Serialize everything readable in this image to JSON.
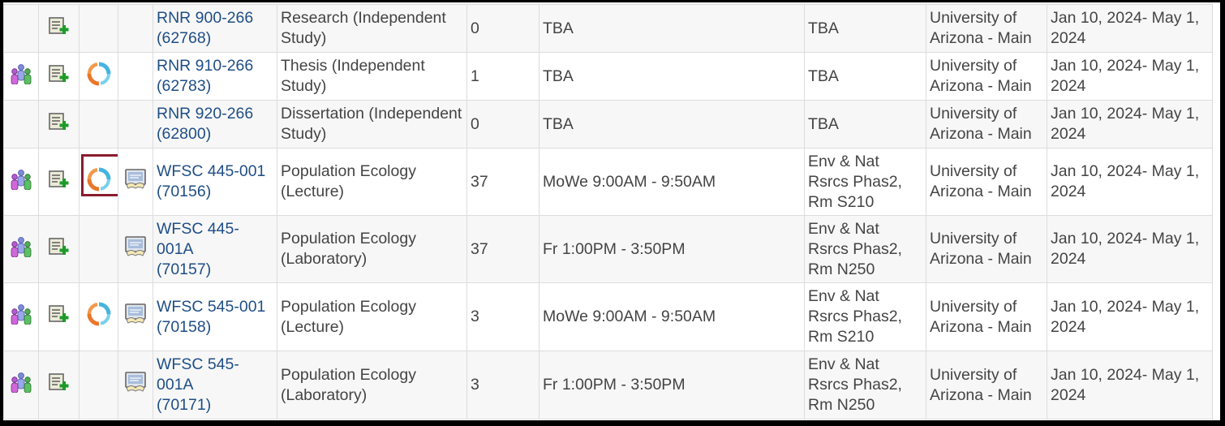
{
  "colors": {
    "link": "#1f4e86",
    "text": "#444444",
    "row_alt": "#f7f7f7",
    "highlight_box": "#8a1c2e"
  },
  "icons": {
    "roster": "group-people-icon",
    "add_to_cart": "add-document-icon",
    "swap": "refresh-cycle-icon",
    "online": "online-course-icon"
  },
  "rows": [
    {
      "has_roster": false,
      "has_add": true,
      "has_swap": false,
      "has_online": false,
      "swap_highlighted": false,
      "class_line1": "RNR 900-266",
      "class_line2": "(62768)",
      "class_line3": "",
      "title": "Research (Independent Study)",
      "enrolled": "0",
      "days_times": "TBA",
      "room": "TBA",
      "campus": "University of Arizona - Main",
      "dates": "Jan 10, 2024- May 1, 2024"
    },
    {
      "has_roster": true,
      "has_add": true,
      "has_swap": true,
      "has_online": false,
      "swap_highlighted": false,
      "class_line1": "RNR 910-266",
      "class_line2": "(62783)",
      "class_line3": "",
      "title": "Thesis (Independent Study)",
      "enrolled": "1",
      "days_times": "TBA",
      "room": "TBA",
      "campus": "University of Arizona - Main",
      "dates": "Jan 10, 2024- May 1, 2024"
    },
    {
      "has_roster": false,
      "has_add": true,
      "has_swap": false,
      "has_online": false,
      "swap_highlighted": false,
      "class_line1": "RNR 920-266",
      "class_line2": "(62800)",
      "class_line3": "",
      "title": "Dissertation (Independent Study)",
      "enrolled": "0",
      "days_times": "TBA",
      "room": "TBA",
      "campus": "University of Arizona - Main",
      "dates": "Jan 10, 2024- May 1, 2024"
    },
    {
      "has_roster": true,
      "has_add": true,
      "has_swap": true,
      "has_online": true,
      "swap_highlighted": true,
      "class_line1": "WFSC 445-001",
      "class_line2": "(70156)",
      "class_line3": "",
      "title": "Population Ecology (Lecture)",
      "enrolled": "37",
      "days_times": "MoWe 9:00AM - 9:50AM",
      "room": "Env & Nat Rsrcs Phas2, Rm S210",
      "campus": "University of Arizona - Main",
      "dates": "Jan 10, 2024- May 1, 2024"
    },
    {
      "has_roster": true,
      "has_add": true,
      "has_swap": false,
      "has_online": true,
      "swap_highlighted": false,
      "class_line1": "WFSC 445-",
      "class_line2": "001A",
      "class_line3": "(70157)",
      "title": "Population Ecology (Laboratory)",
      "enrolled": "37",
      "days_times": "Fr 1:00PM - 3:50PM",
      "room": "Env & Nat Rsrcs Phas2, Rm N250",
      "campus": "University of Arizona - Main",
      "dates": "Jan 10, 2024- May 1, 2024"
    },
    {
      "has_roster": true,
      "has_add": true,
      "has_swap": true,
      "has_online": true,
      "swap_highlighted": false,
      "class_line1": "WFSC 545-001",
      "class_line2": "(70158)",
      "class_line3": "",
      "title": "Population Ecology (Lecture)",
      "enrolled": "3",
      "days_times": "MoWe 9:00AM - 9:50AM",
      "room": "Env & Nat Rsrcs Phas2, Rm S210",
      "campus": "University of Arizona - Main",
      "dates": "Jan 10, 2024- May 1, 2024"
    },
    {
      "has_roster": true,
      "has_add": true,
      "has_swap": false,
      "has_online": true,
      "swap_highlighted": false,
      "class_line1": "WFSC 545-",
      "class_line2": "001A",
      "class_line3": "(70171)",
      "title": "Population Ecology (Laboratory)",
      "enrolled": "3",
      "days_times": "Fr 1:00PM - 3:50PM",
      "room": "Env & Nat Rsrcs Phas2, Rm N250",
      "campus": "University of Arizona - Main",
      "dates": "Jan 10, 2024- May 1, 2024"
    }
  ]
}
